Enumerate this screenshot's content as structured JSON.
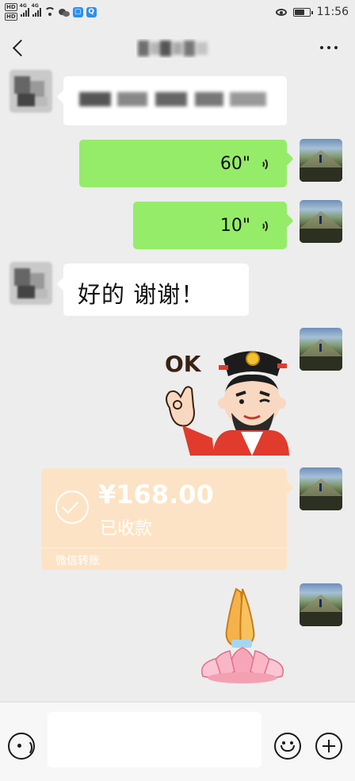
{
  "status_bar": {
    "time": "11:56",
    "hd_label": "HD",
    "network_label": "4G",
    "battery_level": 0.7
  },
  "header": {
    "title": "",
    "back_icon": "chevron-left-icon",
    "more_icon": "more-horizontal-icon"
  },
  "messages": [
    {
      "from": "other",
      "type": "text",
      "text": ""
    },
    {
      "from": "me",
      "type": "voice",
      "duration": "60\""
    },
    {
      "from": "me",
      "type": "voice",
      "duration": "10\""
    },
    {
      "from": "other",
      "type": "text",
      "text": "好的  谢谢！"
    },
    {
      "from": "me",
      "type": "sticker",
      "sticker_text": "OK"
    },
    {
      "from": "me",
      "type": "transfer",
      "amount": "¥168.00",
      "status": "已收款",
      "footer": "微信转账"
    },
    {
      "from": "me",
      "type": "sticker",
      "sticker_name": "praying-hands-lotus-icon"
    }
  ],
  "input_bar": {
    "placeholder": "",
    "voice_icon": "voice-toggle-icon",
    "emoji_icon": "emoji-icon",
    "plus_icon": "plus-icon"
  },
  "colors": {
    "background": "#ededed",
    "my_bubble": "#95ec69",
    "other_bubble": "#ffffff",
    "transfer_card": "#fde3c5"
  }
}
